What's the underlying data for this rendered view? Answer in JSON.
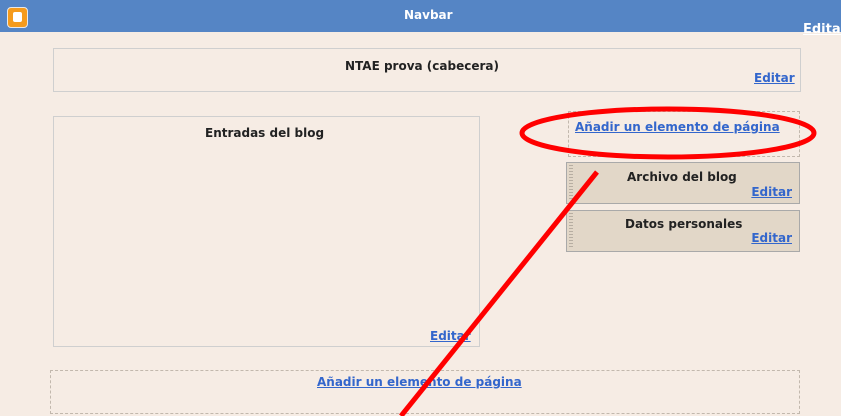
{
  "navbar": {
    "title": "Navbar",
    "edit": "Editar",
    "logo": "blogger-logo-icon"
  },
  "header": {
    "title": "NTAE prova (cabecera)",
    "edit": "Editar"
  },
  "main": {
    "title": "Entradas del blog",
    "edit": "Editar"
  },
  "sidebar": {
    "add_element": "Añadir un elemento de página",
    "gadgets": [
      {
        "title": "Archivo del blog",
        "edit": "Editar"
      },
      {
        "title": "Datos personales",
        "edit": "Editar"
      }
    ]
  },
  "footer": {
    "add_element": "Añadir un elemento de página"
  },
  "colors": {
    "navbar": "#5585c5",
    "background": "#f6ece4",
    "link": "#3366cc",
    "annotation": "#ff0000"
  }
}
